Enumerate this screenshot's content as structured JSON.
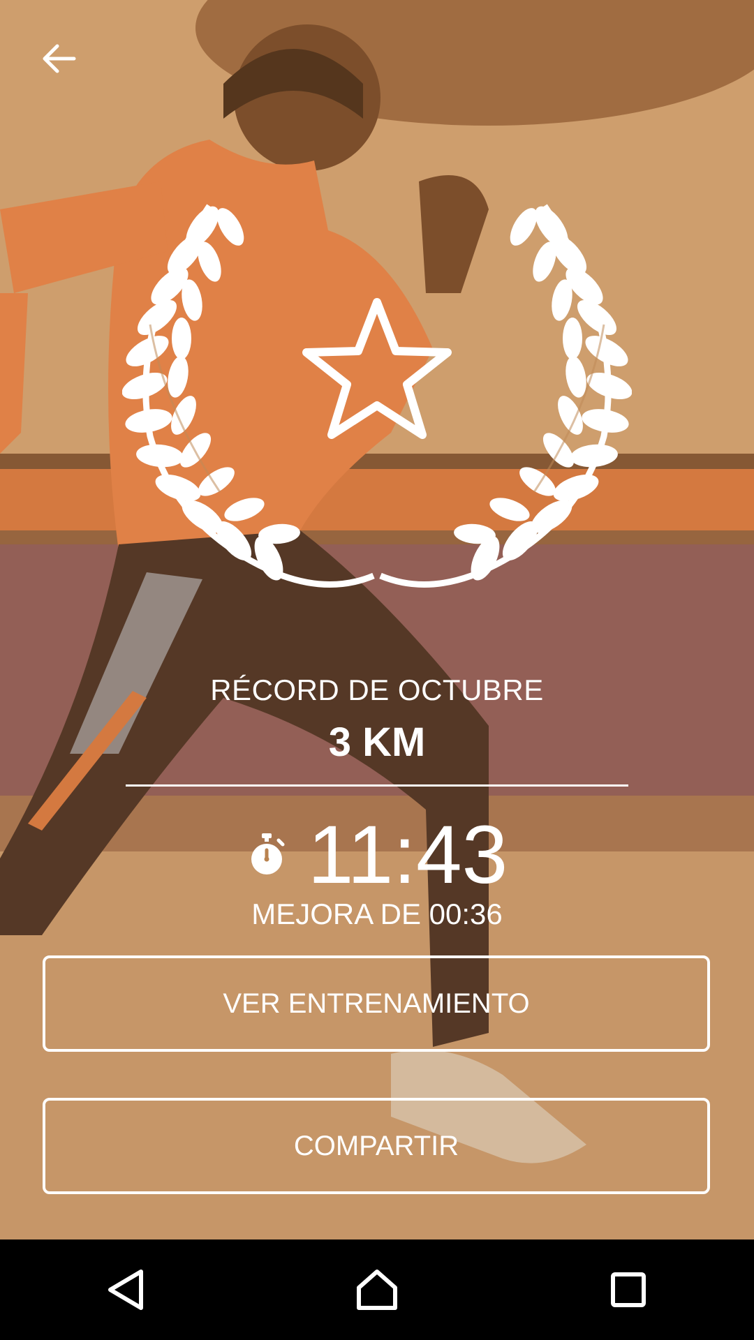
{
  "header": {
    "back_icon": "arrow-left-icon"
  },
  "award": {
    "wreath_icon": "laurel-wreath-icon",
    "star_icon": "star-icon"
  },
  "record": {
    "title": "RÉCORD DE OCTUBRE",
    "distance": "3 KM",
    "timer_icon": "stopwatch-icon",
    "time": "11:43",
    "improvement": "MEJORA DE 00:36"
  },
  "actions": {
    "view_workout_label": "VER ENTRENAMIENTO",
    "share_label": "COMPARTIR"
  },
  "navbar": {
    "back_icon": "triangle-back-icon",
    "home_icon": "home-icon",
    "recents_icon": "square-recents-icon"
  },
  "colors": {
    "overlay": "#b9824f",
    "shirt": "#e8834a",
    "stripe": "#d97941",
    "floor_band": "#8a5a5c",
    "text": "#ffffff",
    "navbar": "#000000"
  }
}
